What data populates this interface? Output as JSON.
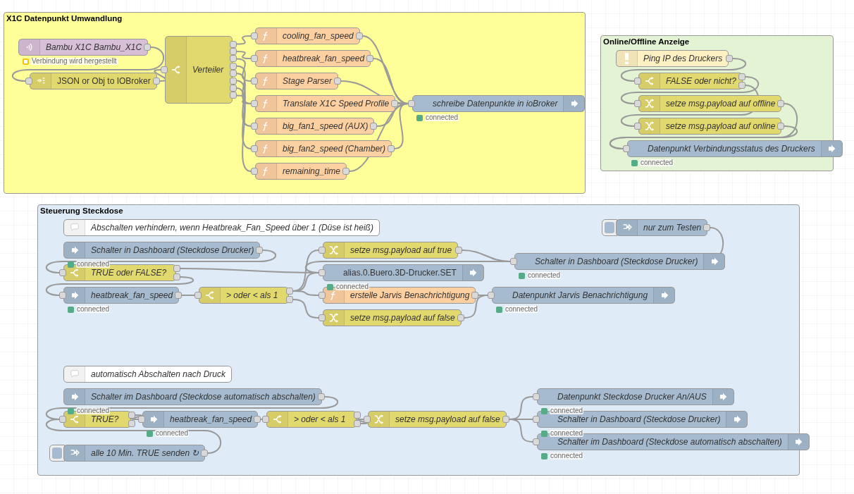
{
  "groups": [
    {
      "label": "X1C Datenpunkt Umwandlung",
      "color": "#ffff99"
    },
    {
      "label": "Online/Offline Anzeige",
      "color": "#e3f3d3"
    },
    {
      "label": "Steuerung Steckdose",
      "color": "#dfebf7"
    }
  ],
  "nodes": [
    {
      "kind": "mqtt-in",
      "label": "Bambu X1C Bambu_X1C",
      "status": {
        "text": "Verbindung wird hergestellt",
        "color": "#f5c400",
        "ring": true
      }
    },
    {
      "kind": "json",
      "label": "JSON or Obj to IOBroker"
    },
    {
      "kind": "switch",
      "label": "Verteiler"
    },
    {
      "kind": "function",
      "label": "cooling_fan_speed"
    },
    {
      "kind": "function",
      "label": "heatbreak_fan_speed"
    },
    {
      "kind": "function",
      "label": "Stage Parser"
    },
    {
      "kind": "function",
      "label": "Translate X1C Speed Profile"
    },
    {
      "kind": "function",
      "label": "big_fan1_speed (AUX)"
    },
    {
      "kind": "function",
      "label": "big_fan2_speed (Chamber)"
    },
    {
      "kind": "function",
      "label": "remaining_time"
    },
    {
      "kind": "iobroker-out",
      "label": "schreibe Datenpunkte in ioBroker",
      "status": {
        "text": "connected",
        "color": "#55aa88"
      }
    },
    {
      "kind": "ping",
      "label": "Ping IP des Druckers"
    },
    {
      "kind": "switch",
      "label": "FALSE oder nicht?"
    },
    {
      "kind": "change",
      "label": "setze msg.payload auf offline"
    },
    {
      "kind": "change",
      "label": "setze msg.payload auf online"
    },
    {
      "kind": "iobroker-out",
      "label": "Datenpunkt Verbindungsstatus des Druckers",
      "status": {
        "text": "connected",
        "color": "#55aa88"
      }
    },
    {
      "kind": "comment",
      "label": "Abschalten verhindern, wenn Heatbreak_Fan_Speed über 1 (Düse ist heiß)"
    },
    {
      "kind": "iobroker-in",
      "label": "Schalter in Dashboard (Steckdose Drucker)",
      "status": {
        "text": "connected",
        "color": "#55aa88"
      }
    },
    {
      "kind": "switch",
      "label": "TRUE oder FALSE?"
    },
    {
      "kind": "iobroker-in",
      "label": "heatbreak_fan_speed",
      "status": {
        "text": "connected",
        "color": "#55aa88"
      }
    },
    {
      "kind": "switch",
      "label": "> oder < als 1"
    },
    {
      "kind": "change",
      "label": "setze msg.payload auf true"
    },
    {
      "kind": "iobroker-out",
      "label": "alias.0.Buero.3D-Drucker.SET",
      "status": {
        "text": "connected",
        "color": "#55aa88"
      }
    },
    {
      "kind": "function",
      "label": "erstelle Jarvis Benachrichtigung"
    },
    {
      "kind": "change",
      "label": "setze msg.payload auf false"
    },
    {
      "kind": "inject",
      "label": "nur zum Testen"
    },
    {
      "kind": "iobroker-out",
      "label": "Schalter in Dashboard (Steckdose Drucker)",
      "status": {
        "text": "connected",
        "color": "#55aa88"
      }
    },
    {
      "kind": "iobroker-out",
      "label": "Datenpunkt Jarvis Benachrichtigung",
      "status": {
        "text": "connected",
        "color": "#55aa88"
      }
    },
    {
      "kind": "comment",
      "label": "automatisch Abschalten nach Druck"
    },
    {
      "kind": "iobroker-in",
      "label": "Schalter im Dashboard (Steckdose automatisch abschalten)",
      "status": {
        "text": "connected",
        "color": "#55aa88"
      }
    },
    {
      "kind": "switch",
      "label": "TRUE?"
    },
    {
      "kind": "iobroker-in",
      "label": "heatbreak_fan_speed",
      "status": {
        "text": "connected",
        "color": "#55aa88"
      }
    },
    {
      "kind": "switch",
      "label": "> oder < als 1"
    },
    {
      "kind": "change",
      "label": "setze msg.payload auf false"
    },
    {
      "kind": "inject",
      "label": "alle 10 Min. TRUE senden ↻"
    },
    {
      "kind": "iobroker-out",
      "label": "Datenpunkt Steckdose Drucker An/AUS",
      "status": {
        "text": "connected",
        "color": "#55aa88"
      }
    },
    {
      "kind": "iobroker-out",
      "label": "Schalter in Dashboard (Steckdose Drucker)",
      "status": {
        "text": "connected",
        "color": "#55aa88"
      }
    },
    {
      "kind": "iobroker-out",
      "label": "Schalter im Dashboard (Steckdose automatisch abschalten)",
      "status": {
        "text": "connected",
        "color": "#55aa88"
      }
    }
  ]
}
